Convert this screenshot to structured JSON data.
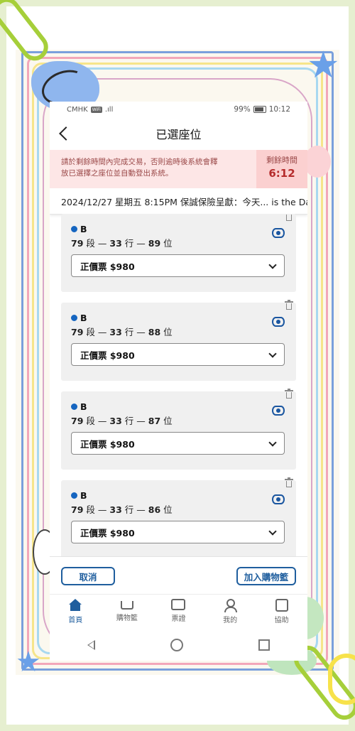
{
  "status_bar": {
    "carrier": "CMHK",
    "wifi_badge": "WiFi",
    "signal": ".ıll",
    "battery": "99%",
    "time": "10:12"
  },
  "header": {
    "title": "已選座位"
  },
  "timer": {
    "message_line1": "請於剩餘時間內完成交易，否則逾時後系統會釋",
    "message_line2": "放已選擇之座位並自動登出系統。",
    "label": "剩餘時間",
    "value": "6:12"
  },
  "event": {
    "text": "2024/12/27 星期五 8:15PM 保誠保險呈獻：今天... is the Da"
  },
  "seats": [
    {
      "zone": "B",
      "section": "79",
      "section_unit": "段",
      "row": "33",
      "row_unit": "行",
      "seat": "89",
      "seat_unit": "位",
      "dash": "—",
      "ticket": "正價票 $980"
    },
    {
      "zone": "B",
      "section": "79",
      "section_unit": "段",
      "row": "33",
      "row_unit": "行",
      "seat": "88",
      "seat_unit": "位",
      "dash": "—",
      "ticket": "正價票 $980"
    },
    {
      "zone": "B",
      "section": "79",
      "section_unit": "段",
      "row": "33",
      "row_unit": "行",
      "seat": "87",
      "seat_unit": "位",
      "dash": "—",
      "ticket": "正價票 $980"
    },
    {
      "zone": "B",
      "section": "79",
      "section_unit": "段",
      "row": "33",
      "row_unit": "行",
      "seat": "86",
      "seat_unit": "位",
      "dash": "—",
      "ticket": "正價票 $980"
    }
  ],
  "actions": {
    "cancel": "取消",
    "add_to_cart": "加入購物籃"
  },
  "tabs": [
    {
      "label": "首頁",
      "icon": "home-icon"
    },
    {
      "label": "購物籃",
      "icon": "cart-icon"
    },
    {
      "label": "票證",
      "icon": "ticket-icon"
    },
    {
      "label": "我的",
      "icon": "user-icon"
    },
    {
      "label": "協助",
      "icon": "help-icon"
    }
  ],
  "colors": {
    "accent": "#1f5e9e",
    "timer_bg": "#fde6e6",
    "timer_value": "#b52b2b",
    "zone_dot": "#1565c0"
  }
}
